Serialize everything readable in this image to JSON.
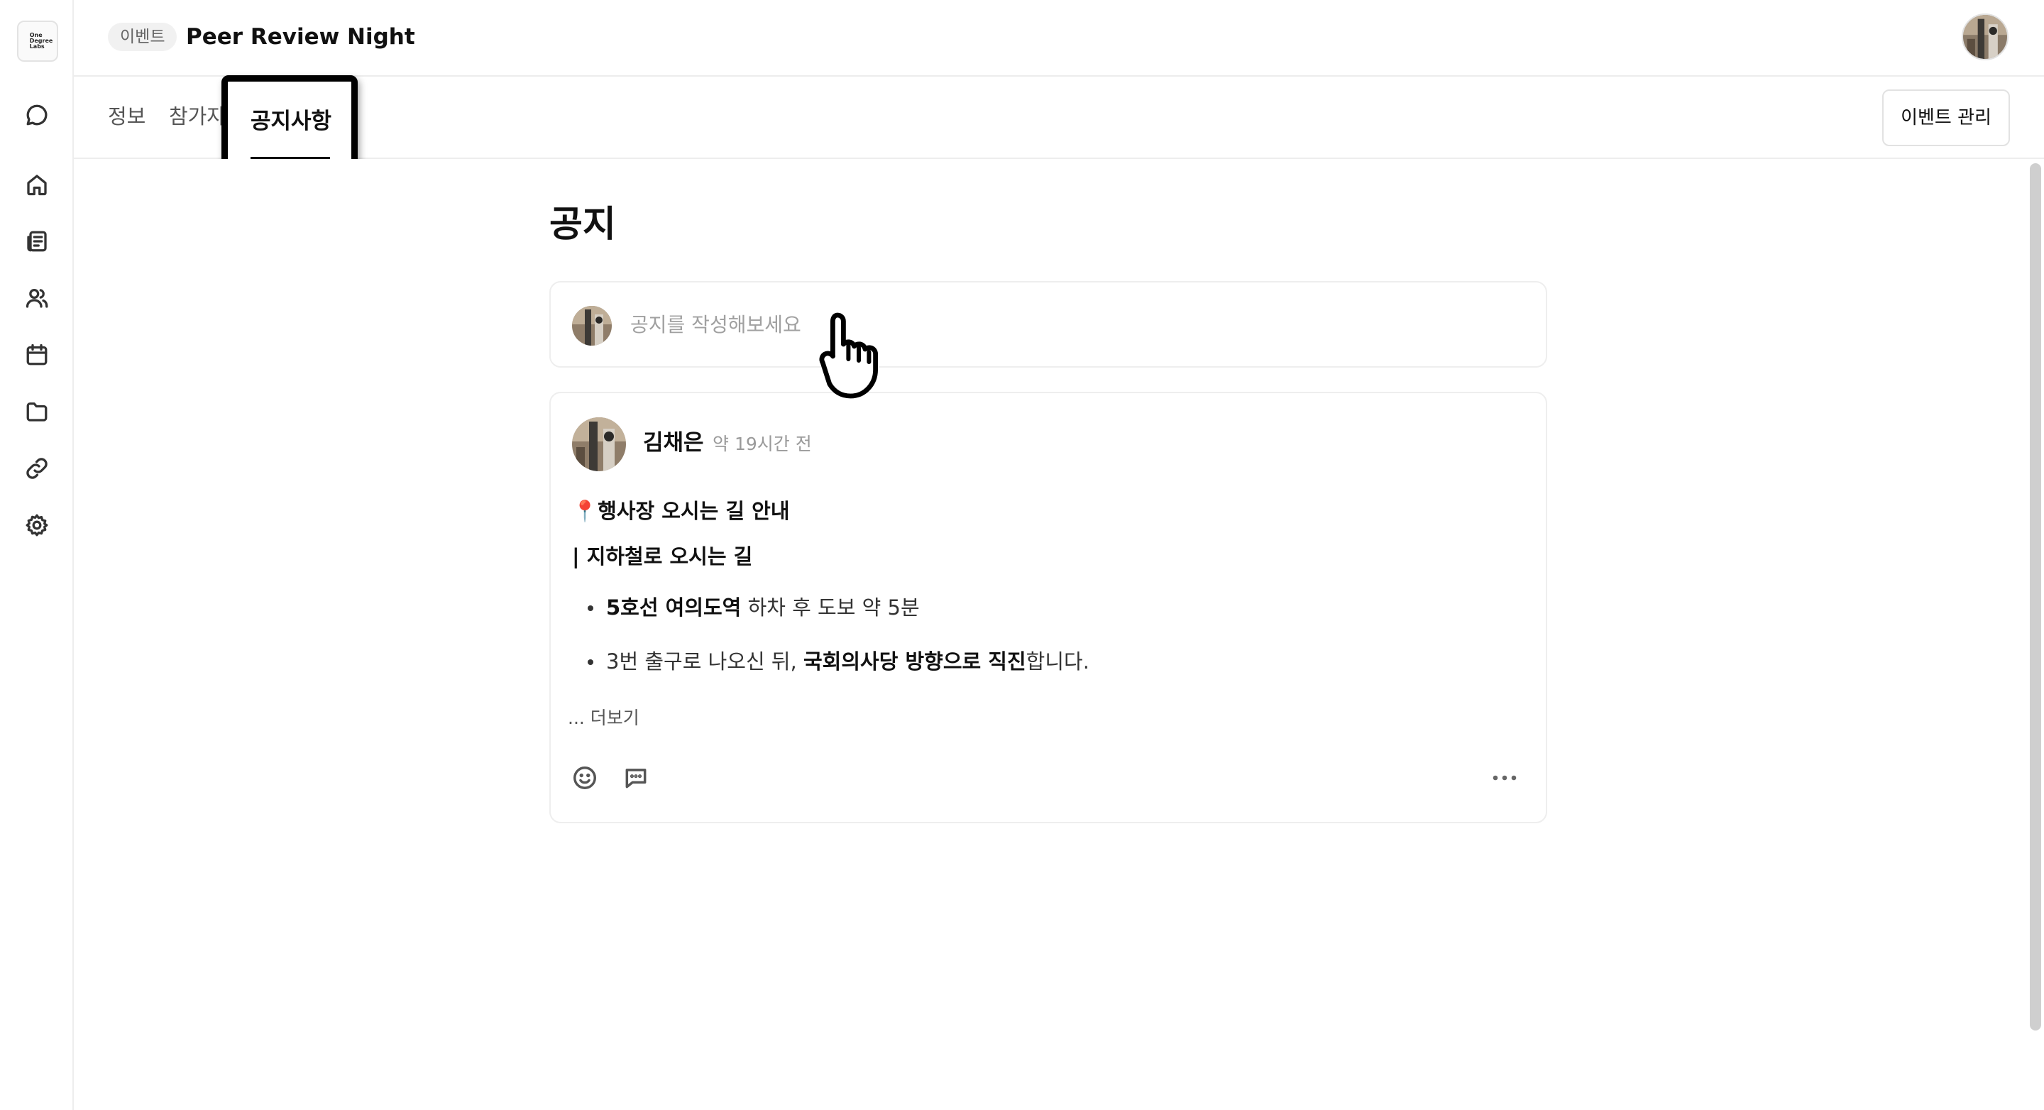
{
  "sidebar": {
    "logo_text": "One\nDegree\nLabs",
    "items": [
      {
        "name": "messages",
        "icon": "chat-bubble-icon"
      },
      {
        "name": "home",
        "icon": "home-icon"
      },
      {
        "name": "feed",
        "icon": "newspaper-icon"
      },
      {
        "name": "people",
        "icon": "users-icon"
      },
      {
        "name": "calendar",
        "icon": "calendar-icon"
      },
      {
        "name": "files",
        "icon": "folder-icon"
      },
      {
        "name": "links",
        "icon": "link-icon"
      },
      {
        "name": "settings",
        "icon": "gear-icon"
      }
    ]
  },
  "header": {
    "badge": "이벤트",
    "title": "Peer Review Night"
  },
  "tabs": {
    "info": "정보",
    "participants": "참가자",
    "notices": "공지사항"
  },
  "manage_button": "이벤트 관리",
  "main": {
    "page_title": "공지",
    "compose_placeholder": "공지를 작성해보세요"
  },
  "post": {
    "author": "김채은",
    "time": "약 19시간 전",
    "heading": "📍행사장 오시는 길 안내",
    "subheading": "| 지하철로 오시는 길",
    "bullets": [
      {
        "bold": "5호선 여의도역",
        "rest": " 하차 후 도보 약 5분"
      },
      {
        "pre": "3번 출구로 나오신 뒤, ",
        "bold": "국회의사당 방향으로 직진",
        "rest": "합니다."
      }
    ],
    "more": "... 더보기"
  },
  "colors": {
    "border": "#ededed",
    "text": "#111111",
    "muted": "#9a9a9a",
    "active_tab_highlight": "#000000"
  }
}
